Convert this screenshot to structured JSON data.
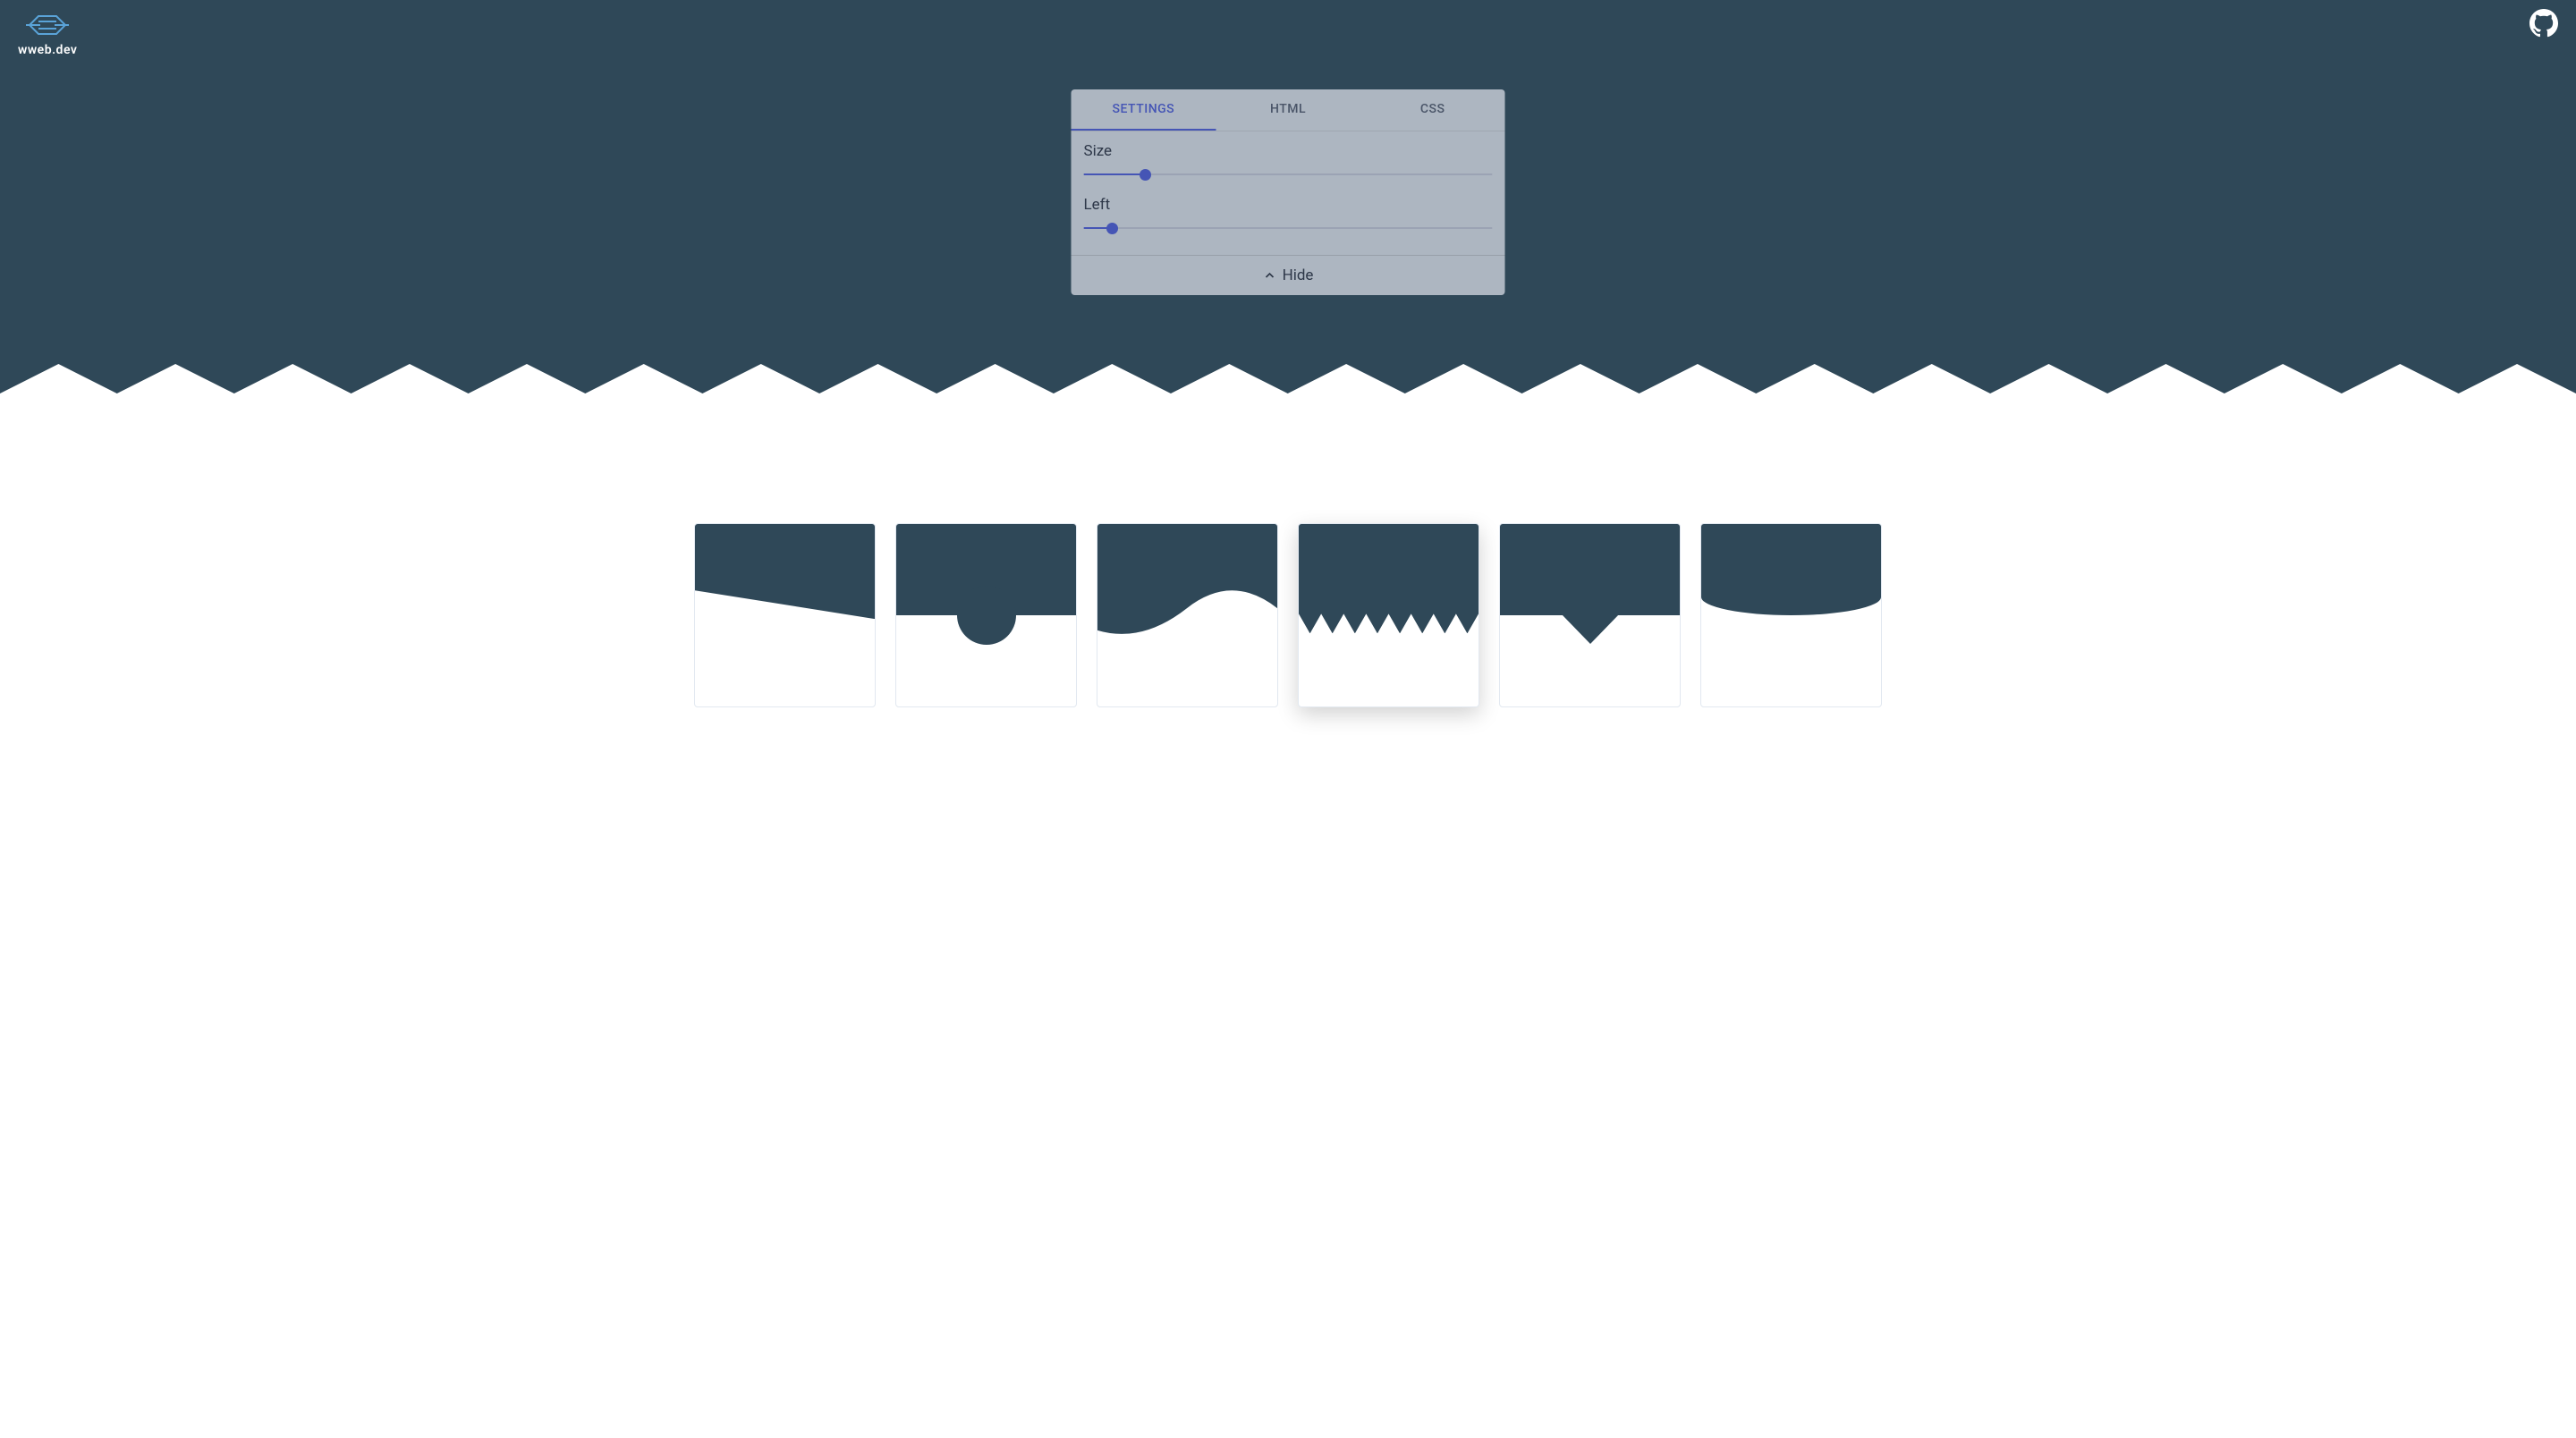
{
  "site": {
    "name": "wweb.dev"
  },
  "panel": {
    "tabs": [
      {
        "label": "SETTINGS",
        "active": true
      },
      {
        "label": "HTML",
        "active": false
      },
      {
        "label": "CSS",
        "active": false
      }
    ],
    "controls": {
      "size": {
        "label": "Size",
        "value": 15
      },
      "left": {
        "label": "Left",
        "value": 7
      }
    },
    "hide_label": "Hide"
  },
  "separators": [
    {
      "name": "diagonal",
      "selected": false
    },
    {
      "name": "semicircle",
      "selected": false
    },
    {
      "name": "wave",
      "selected": false
    },
    {
      "name": "zigzag",
      "selected": true
    },
    {
      "name": "triangle",
      "selected": false
    },
    {
      "name": "curve",
      "selected": false
    }
  ],
  "colors": {
    "primary": "#2f4858",
    "accent": "#4555b5",
    "panel_bg": "rgba(191, 197, 207, 0.88)"
  }
}
